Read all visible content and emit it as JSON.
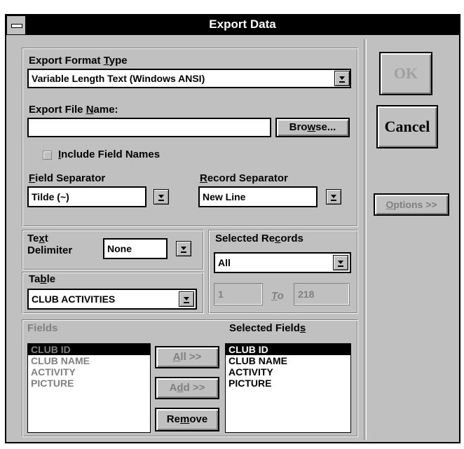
{
  "window": {
    "title": "Export Data"
  },
  "export_format": {
    "label": "Export Format Type",
    "value": "Variable Length Text (Windows ANSI)"
  },
  "export_file": {
    "label": "Export File Name:",
    "value": "",
    "browse_label": "Browse..."
  },
  "include_field_names": {
    "label": "Include Field Names",
    "checked": false
  },
  "field_separator": {
    "label": "Field Separator",
    "value": "Tilde (~)"
  },
  "record_separator": {
    "label": "Record Separator",
    "value": "New Line"
  },
  "text_delimiter": {
    "label_line1": "Text",
    "label_line2": "Delimiter",
    "value": "None"
  },
  "selected_records": {
    "label": "Selected Records",
    "value": "All",
    "from": "1",
    "to_label": "To",
    "to": "218"
  },
  "table": {
    "label": "Table",
    "value": "CLUB ACTIVITIES"
  },
  "fields": {
    "label": "Fields",
    "items": [
      "CLUB ID",
      "CLUB NAME",
      "ACTIVITY",
      "PICTURE"
    ]
  },
  "selected_fields": {
    "label": "Selected Fields",
    "items": [
      "CLUB ID",
      "CLUB NAME",
      "ACTIVITY",
      "PICTURE"
    ]
  },
  "buttons": {
    "ok": "OK",
    "cancel": "Cancel",
    "options": "Options >>",
    "all": "All >>",
    "add": "Add >>",
    "remove": "Remove"
  },
  "colors": {
    "face": "#c0c0c0",
    "title_bar": "#000000",
    "disabled_text": "#808080",
    "selection": "#000000"
  }
}
